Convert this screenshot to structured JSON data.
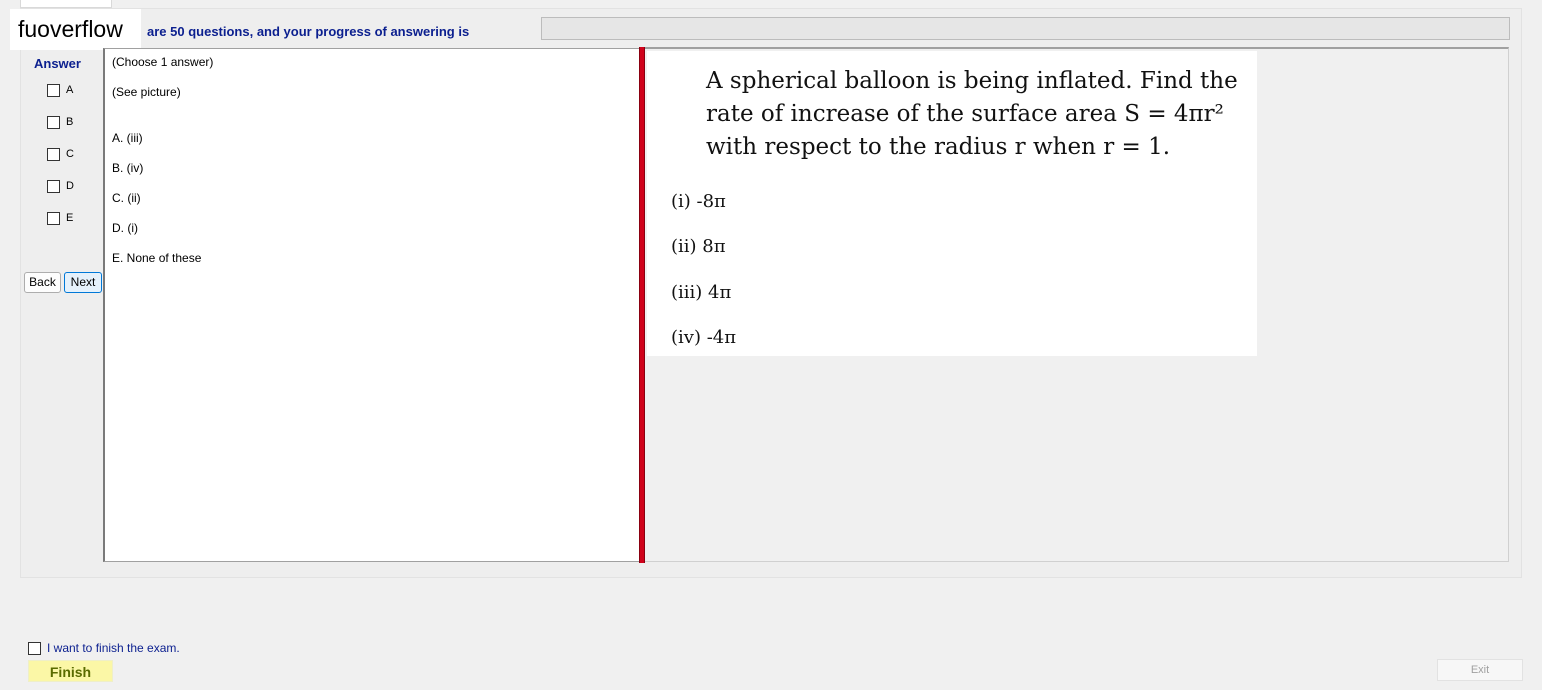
{
  "header": {
    "watermark": "fuoverflow",
    "progress_text": "are 50 questions, and your progress of answering is",
    "progress_percent": 0
  },
  "answer_panel": {
    "title": "Answer",
    "options": [
      "A",
      "B",
      "C",
      "D",
      "E"
    ],
    "back_label": "Back",
    "next_label": "Next"
  },
  "question": {
    "instruction": "(Choose 1 answer)",
    "picture_note": "(See picture)",
    "answers": [
      "A. (iii)",
      "B. (iv)",
      "C. (ii)",
      "D. (i)",
      "E. None of these"
    ]
  },
  "picture": {
    "problem_lines": [
      "A spherical balloon is being inflated. Find the",
      "rate of increase of the surface area S = 4πr²",
      "with respect to the radius r when r = 1."
    ],
    "choices": [
      "(i) -8π",
      "(ii) 8π",
      "(iii) 4π",
      "(iv) -4π"
    ]
  },
  "footer": {
    "finish_check_label": "I want to finish the exam.",
    "finish_label": "Finish",
    "exit_label": "Exit"
  },
  "colors": {
    "heading_blue": "#0b1f8f",
    "splitter_red": "#d0021b",
    "finish_yellow": "#fbf7a6"
  }
}
